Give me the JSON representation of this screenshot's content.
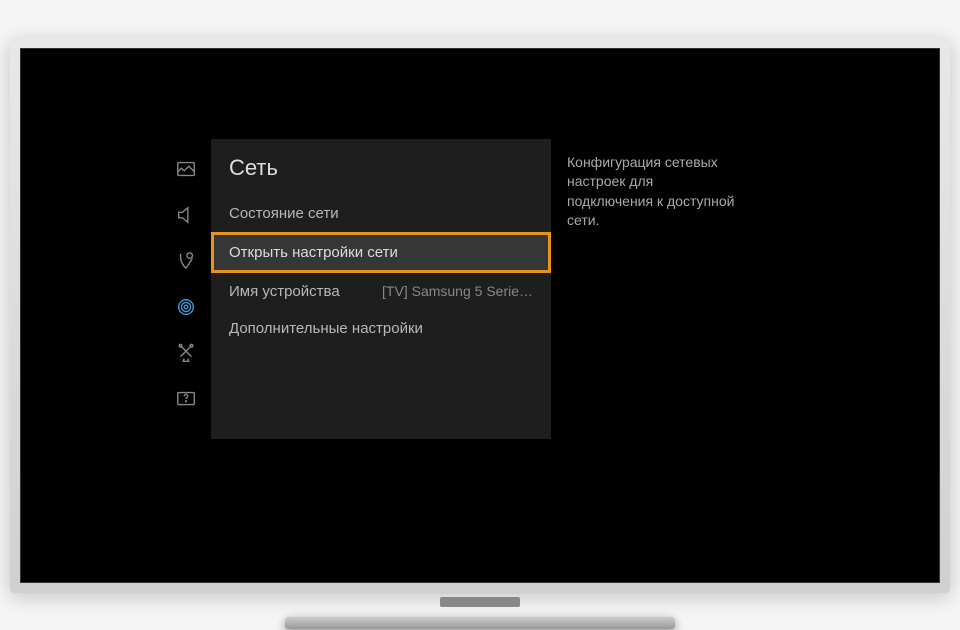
{
  "panel": {
    "title": "Сеть",
    "items": [
      {
        "label": "Состояние сети",
        "value": ""
      },
      {
        "label": "Открыть настройки сети",
        "value": ""
      },
      {
        "label": "Имя устройства",
        "value": "[TV] Samsung 5 Serie…"
      },
      {
        "label": "Дополнительные настройки",
        "value": ""
      }
    ]
  },
  "help": "Конфигурация сетевых настроек для подключения к доступной сети.",
  "rail": {
    "icons": [
      "picture",
      "sound",
      "broadcast",
      "network",
      "system",
      "support"
    ]
  }
}
